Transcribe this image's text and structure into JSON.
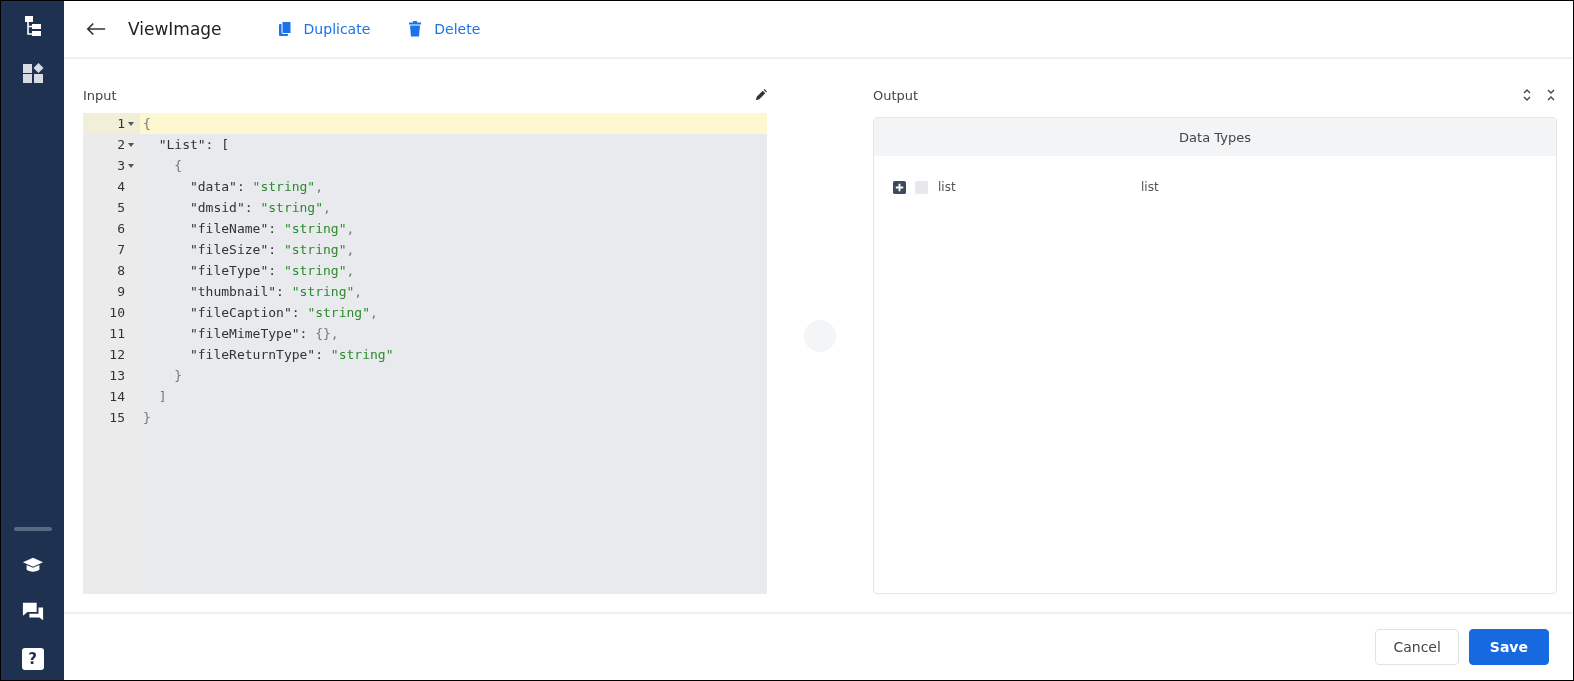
{
  "header": {
    "title": "ViewImage",
    "actions": [
      {
        "kind": "duplicate",
        "label": "Duplicate"
      },
      {
        "kind": "delete",
        "label": "Delete"
      }
    ]
  },
  "sidebar": {
    "top_items": [
      {
        "kind": "tree"
      },
      {
        "kind": "apps"
      }
    ],
    "bottom_items": [
      {
        "kind": "learn"
      },
      {
        "kind": "chat"
      },
      {
        "kind": "help",
        "glyph": "?"
      }
    ]
  },
  "input": {
    "label": "Input",
    "lines": [
      {
        "number": "1",
        "foldable": true,
        "active": true,
        "tokens": [
          {
            "kind": "punct",
            "text": "{"
          }
        ]
      },
      {
        "number": "2",
        "foldable": true,
        "active": false,
        "tokens": [
          {
            "kind": "key",
            "text": "  \"List\": ["
          }
        ]
      },
      {
        "number": "3",
        "foldable": true,
        "active": false,
        "tokens": [
          {
            "kind": "punct",
            "text": "    {"
          }
        ]
      },
      {
        "number": "4",
        "foldable": false,
        "active": false,
        "tokens": [
          {
            "kind": "key",
            "text": "      \"data\": "
          },
          {
            "kind": "string",
            "text": "\"string\""
          },
          {
            "kind": "punct",
            "text": ","
          }
        ]
      },
      {
        "number": "5",
        "foldable": false,
        "active": false,
        "tokens": [
          {
            "kind": "key",
            "text": "      \"dmsid\": "
          },
          {
            "kind": "string",
            "text": "\"string\""
          },
          {
            "kind": "punct",
            "text": ","
          }
        ]
      },
      {
        "number": "6",
        "foldable": false,
        "active": false,
        "tokens": [
          {
            "kind": "key",
            "text": "      \"fileName\": "
          },
          {
            "kind": "string",
            "text": "\"string\""
          },
          {
            "kind": "punct",
            "text": ","
          }
        ]
      },
      {
        "number": "7",
        "foldable": false,
        "active": false,
        "tokens": [
          {
            "kind": "key",
            "text": "      \"fileSize\": "
          },
          {
            "kind": "string",
            "text": "\"string\""
          },
          {
            "kind": "punct",
            "text": ","
          }
        ]
      },
      {
        "number": "8",
        "foldable": false,
        "active": false,
        "tokens": [
          {
            "kind": "key",
            "text": "      \"fileType\": "
          },
          {
            "kind": "string",
            "text": "\"string\""
          },
          {
            "kind": "punct",
            "text": ","
          }
        ]
      },
      {
        "number": "9",
        "foldable": false,
        "active": false,
        "tokens": [
          {
            "kind": "key",
            "text": "      \"thumbnail\": "
          },
          {
            "kind": "string",
            "text": "\"string\""
          },
          {
            "kind": "punct",
            "text": ","
          }
        ]
      },
      {
        "number": "10",
        "foldable": false,
        "active": false,
        "tokens": [
          {
            "kind": "key",
            "text": "      \"fileCaption\": "
          },
          {
            "kind": "string",
            "text": "\"string\""
          },
          {
            "kind": "punct",
            "text": ","
          }
        ]
      },
      {
        "number": "11",
        "foldable": false,
        "active": false,
        "tokens": [
          {
            "kind": "key",
            "text": "      \"fileMimeType\": "
          },
          {
            "kind": "punct",
            "text": "{},"
          }
        ]
      },
      {
        "number": "12",
        "foldable": false,
        "active": false,
        "tokens": [
          {
            "kind": "key",
            "text": "      \"fileReturnType\": "
          },
          {
            "kind": "string",
            "text": "\"string\""
          }
        ]
      },
      {
        "number": "13",
        "foldable": false,
        "active": false,
        "tokens": [
          {
            "kind": "punct",
            "text": "    }"
          }
        ]
      },
      {
        "number": "14",
        "foldable": false,
        "active": false,
        "tokens": [
          {
            "kind": "punct",
            "text": "  ]"
          }
        ]
      },
      {
        "number": "15",
        "foldable": false,
        "active": false,
        "tokens": [
          {
            "kind": "punct",
            "text": "}"
          }
        ]
      }
    ]
  },
  "output": {
    "label": "Output",
    "table_title": "Data Types",
    "rows": [
      {
        "name": "list",
        "type": "list",
        "expanded": false,
        "checked": false
      }
    ]
  },
  "footer": {
    "buttons": [
      {
        "kind": "secondary",
        "label": "Cancel"
      },
      {
        "kind": "primary",
        "label": "Save"
      }
    ]
  }
}
